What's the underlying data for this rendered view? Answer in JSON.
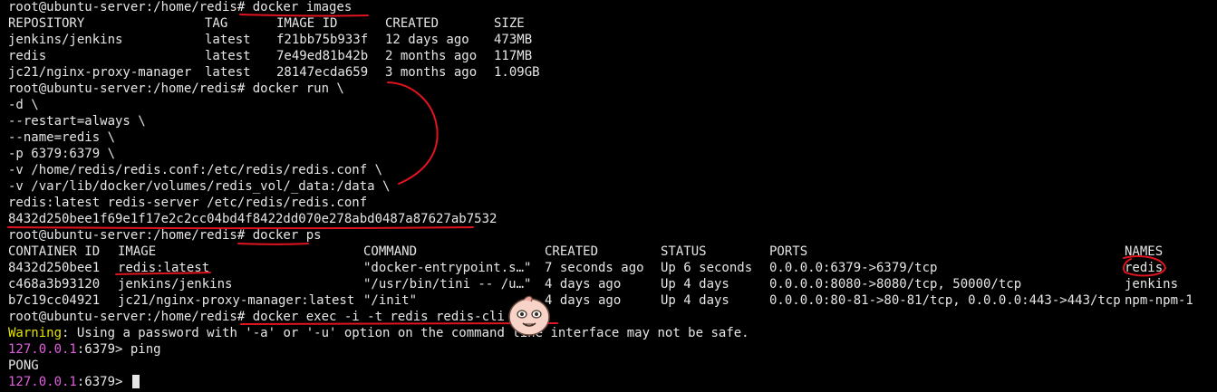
{
  "lines": {
    "l1": "root@ubuntu-server:/home/redis# docker images",
    "l9": "-v /home/redis/redis.conf:/etc/redis/redis.conf \\",
    "l10": "-v /var/lib/docker/volumes/redis_vol/_data:/data \\",
    "l11": "redis:latest redis-server /etc/redis/redis.conf",
    "l12": "8432d250bee1f69e1f17e2c2cc04bd4f8422dd070e278abd0487a87627ab7532",
    "l13": "root@ubuntu-server:/home/redis# docker ps",
    "l18": "root@ubuntu-server:/home/redis# docker exec -i -t redis redis-cli -a ",
    "l20_cmd": "ping",
    "l21": "PONG"
  },
  "images": {
    "headers": [
      "REPOSITORY",
      "TAG",
      "IMAGE ID",
      "CREATED",
      "SIZE"
    ],
    "rows": [
      [
        "jenkins/jenkins",
        "latest",
        "f21bb75b933f",
        "12 days ago",
        "473MB"
      ],
      [
        "redis",
        "latest",
        "7e49ed81b42b",
        "2 months ago",
        "117MB"
      ],
      [
        "jc21/nginx-proxy-manager",
        "latest",
        "28147ecda659",
        "3 months ago",
        "1.09GB"
      ]
    ]
  },
  "run_lines": [
    "root@ubuntu-server:/home/redis# docker run \\",
    "-d \\",
    "--restart=always \\",
    "--name=redis \\",
    "-p 6379:6379 \\"
  ],
  "ps": {
    "headers": [
      "CONTAINER ID",
      "IMAGE",
      "COMMAND",
      "CREATED",
      "STATUS",
      "PORTS",
      "NAMES"
    ],
    "rows": [
      [
        "8432d250bee1",
        "redis:latest",
        "\"docker-entrypoint.s…\"",
        "7 seconds ago",
        "Up 6 seconds",
        "0.0.0.0:6379->6379/tcp",
        "redis"
      ],
      [
        "c468a3b93120",
        "jenkins/jenkins",
        "\"/usr/bin/tini -- /u…\"",
        "4 days ago",
        "Up 4 days",
        "0.0.0.0:8080->8080/tcp, 50000/tcp",
        "jenkins"
      ],
      [
        "b7c19cc04921",
        "jc21/nginx-proxy-manager:latest",
        "\"/init\"",
        "4 days ago",
        "Up 4 days",
        "0.0.0.0:80-81->80-81/tcp, 0.0.0.0:443->443/tcp",
        "npm-npm-1"
      ]
    ]
  },
  "warning": {
    "label": "Warning",
    "text": ": Using a password with '-a' or '-u' option on the command line interface may not be safe."
  },
  "redis_prompt": {
    "host": "127.0.0.1",
    "port_suffix": ":6379> "
  },
  "annotation_color": "#e0141e",
  "icons": {
    "sticker": "peach-character-sticker-icon"
  }
}
